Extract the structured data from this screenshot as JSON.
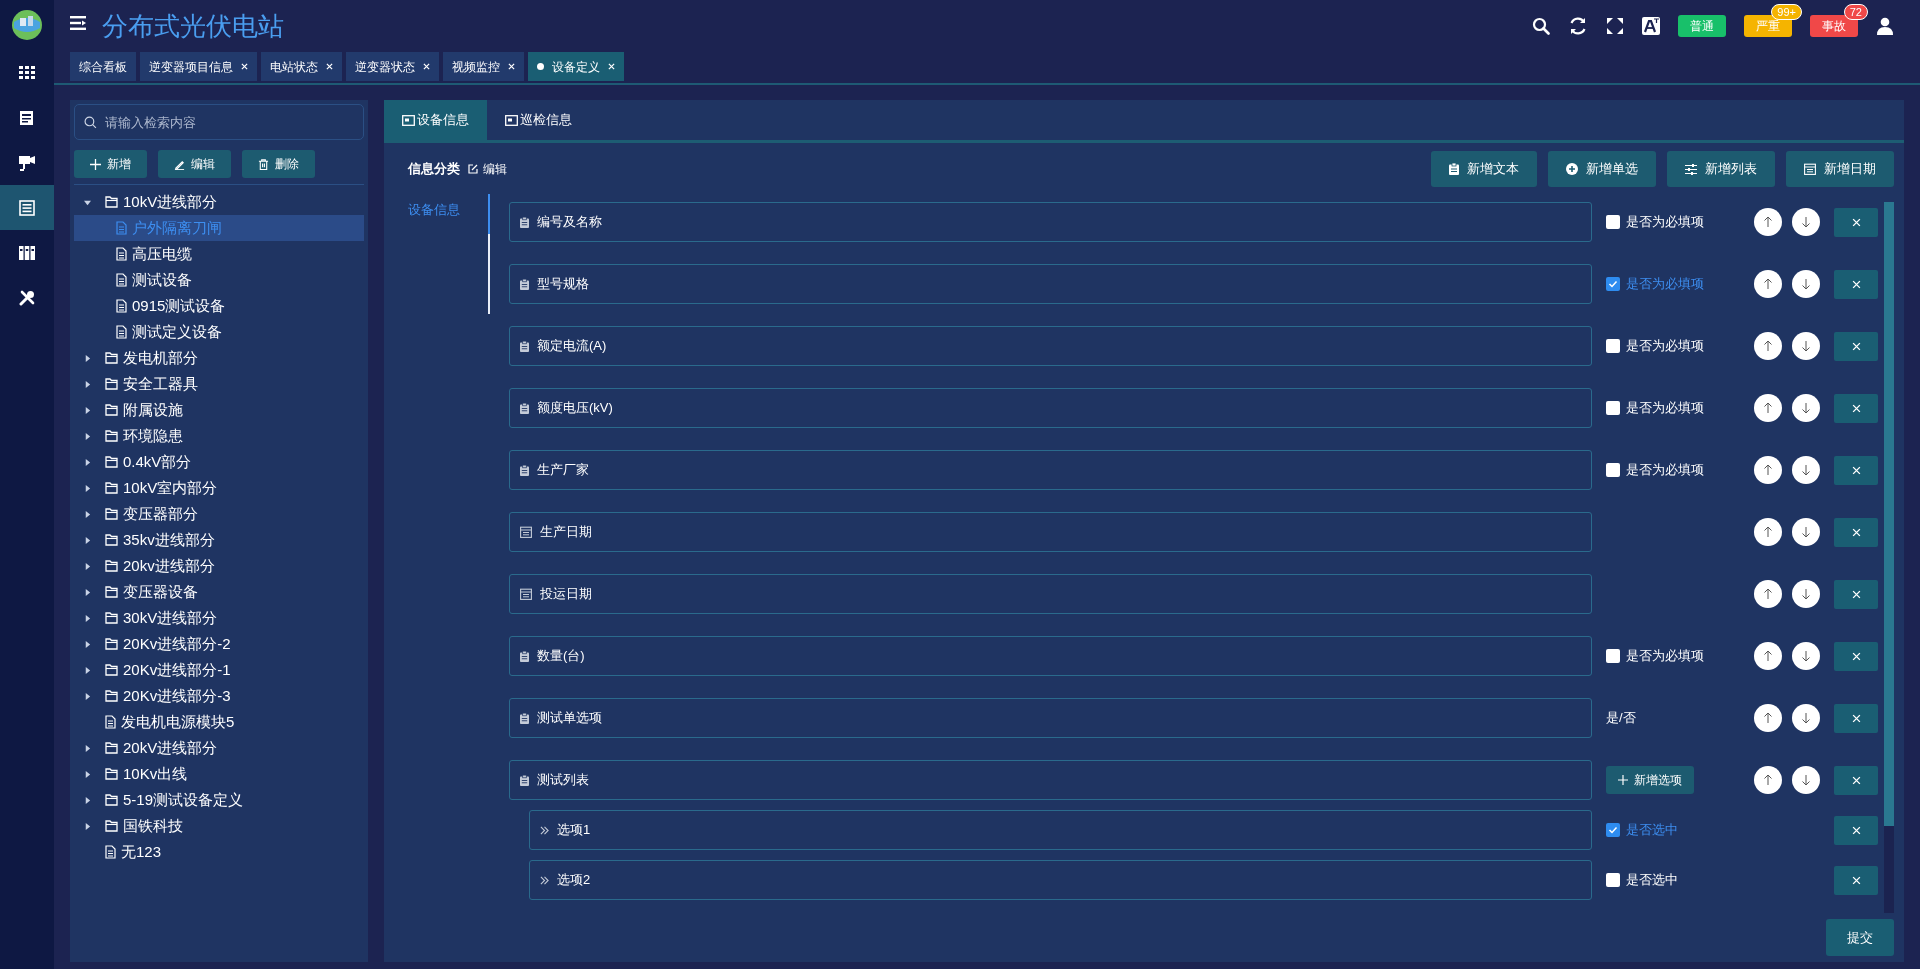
{
  "app": {
    "title": "分布式光伏电站"
  },
  "rail": [
    {
      "selected": false
    },
    {
      "selected": false
    },
    {
      "selected": false
    },
    {
      "selected": true
    },
    {
      "selected": false
    },
    {
      "selected": false
    }
  ],
  "alerts": [
    {
      "label": "普通",
      "color": "#18c06a"
    },
    {
      "label": "严重",
      "color": "#f5b400",
      "count": "99+"
    },
    {
      "label": "事故",
      "color": "#f04848",
      "count": "72"
    }
  ],
  "page_tabs": [
    {
      "label": "综合看板",
      "closable": false,
      "selected": false
    },
    {
      "label": "逆变器项目信息",
      "closable": true,
      "selected": false
    },
    {
      "label": "电站状态",
      "closable": true,
      "selected": false
    },
    {
      "label": "逆变器状态",
      "closable": true,
      "selected": false
    },
    {
      "label": "视频监控",
      "closable": true,
      "selected": false
    },
    {
      "label": "设备定义",
      "closable": true,
      "selected": true
    }
  ],
  "tree_panel": {
    "search": {
      "placeholder": "请输入检索内容"
    },
    "buttons": [
      {
        "kind": "add",
        "label": "新增"
      },
      {
        "kind": "edit",
        "label": "编辑"
      },
      {
        "kind": "delete",
        "label": "删除"
      }
    ],
    "items": [
      {
        "kind": "folder",
        "label": "10kV进线部分",
        "expanded": true,
        "selected": false,
        "children": [
          {
            "kind": "file",
            "label": "户外隔离刀闸",
            "selected": true
          },
          {
            "kind": "file",
            "label": "高压电缆",
            "selected": false
          },
          {
            "kind": "file",
            "label": "测试设备",
            "selected": false
          },
          {
            "kind": "file",
            "label": "0915测试设备",
            "selected": false
          },
          {
            "kind": "file",
            "label": "测试定义设备",
            "selected": false
          }
        ]
      },
      {
        "kind": "folder",
        "label": "发电机部分",
        "expanded": false,
        "selected": false
      },
      {
        "kind": "folder",
        "label": "安全工器具",
        "expanded": false,
        "selected": false
      },
      {
        "kind": "folder",
        "label": "附属设施",
        "expanded": false,
        "selected": false
      },
      {
        "kind": "folder",
        "label": "环境隐患",
        "expanded": false,
        "selected": false
      },
      {
        "kind": "folder",
        "label": "0.4kV部分",
        "expanded": false,
        "selected": false
      },
      {
        "kind": "folder",
        "label": "10kV室内部分",
        "expanded": false,
        "selected": false
      },
      {
        "kind": "folder",
        "label": "变压器部分",
        "expanded": false,
        "selected": false
      },
      {
        "kind": "folder",
        "label": "35kv进线部分",
        "expanded": false,
        "selected": false
      },
      {
        "kind": "folder",
        "label": "20kv进线部分",
        "expanded": false,
        "selected": false
      },
      {
        "kind": "folder",
        "label": "变压器设备",
        "expanded": false,
        "selected": false
      },
      {
        "kind": "folder",
        "label": "30kV进线部分",
        "expanded": false,
        "selected": false
      },
      {
        "kind": "folder",
        "label": "20Kv进线部分-2",
        "expanded": false,
        "selected": false
      },
      {
        "kind": "folder",
        "label": "20Kv进线部分-1",
        "expanded": false,
        "selected": false
      },
      {
        "kind": "folder",
        "label": "20Kv进线部分-3",
        "expanded": false,
        "selected": false
      },
      {
        "kind": "file",
        "label": "发电机电源模块5",
        "selected": false
      },
      {
        "kind": "folder",
        "label": "20kV进线部分",
        "expanded": false,
        "selected": false
      },
      {
        "kind": "folder",
        "label": "10Kv出线",
        "expanded": false,
        "selected": false
      },
      {
        "kind": "folder",
        "label": "5-19测试设备定义",
        "expanded": false,
        "selected": false
      },
      {
        "kind": "folder",
        "label": "国铁科技",
        "expanded": false,
        "selected": false
      },
      {
        "kind": "file",
        "label": "无123",
        "selected": false
      }
    ]
  },
  "detail": {
    "tabs": [
      {
        "label": "设备信息",
        "selected": true
      },
      {
        "label": "巡检信息",
        "selected": false
      }
    ],
    "section_title": "信息分类",
    "section_edit": "编辑",
    "add_buttons": [
      {
        "kind": "text",
        "label": "新增文本"
      },
      {
        "kind": "radio",
        "label": "新增单选"
      },
      {
        "kind": "list",
        "label": "新增列表"
      },
      {
        "kind": "date",
        "label": "新增日期"
      }
    ],
    "categories": [
      {
        "label": "设备信息",
        "selected": true
      }
    ],
    "fields": [
      {
        "kind": "text",
        "label": "编号及名称",
        "required_label": "是否为必填项",
        "required": false
      },
      {
        "kind": "text",
        "label": "型号规格",
        "required_label": "是否为必填项",
        "required": true
      },
      {
        "kind": "text",
        "label": "额定电流(A)",
        "required_label": "是否为必填项",
        "required": false
      },
      {
        "kind": "text",
        "label": "额度电压(kV)",
        "required_label": "是否为必填项",
        "required": false
      },
      {
        "kind": "text",
        "label": "生产厂家",
        "required_label": "是否为必填项",
        "required": false
      },
      {
        "kind": "date",
        "label": "生产日期"
      },
      {
        "kind": "date",
        "label": "投运日期"
      },
      {
        "kind": "text",
        "label": "数量(台)",
        "required_label": "是否为必填项",
        "required": false
      },
      {
        "kind": "radio",
        "label": "测试单选项",
        "choices": "是/否"
      },
      {
        "kind": "list",
        "label": "测试列表",
        "add_option": "新增选项",
        "options": [
          {
            "label": "选项1",
            "check_label": "是否选中",
            "checked": true
          },
          {
            "label": "选项2",
            "check_label": "是否选中",
            "checked": false
          }
        ]
      }
    ],
    "submit": "提交"
  }
}
